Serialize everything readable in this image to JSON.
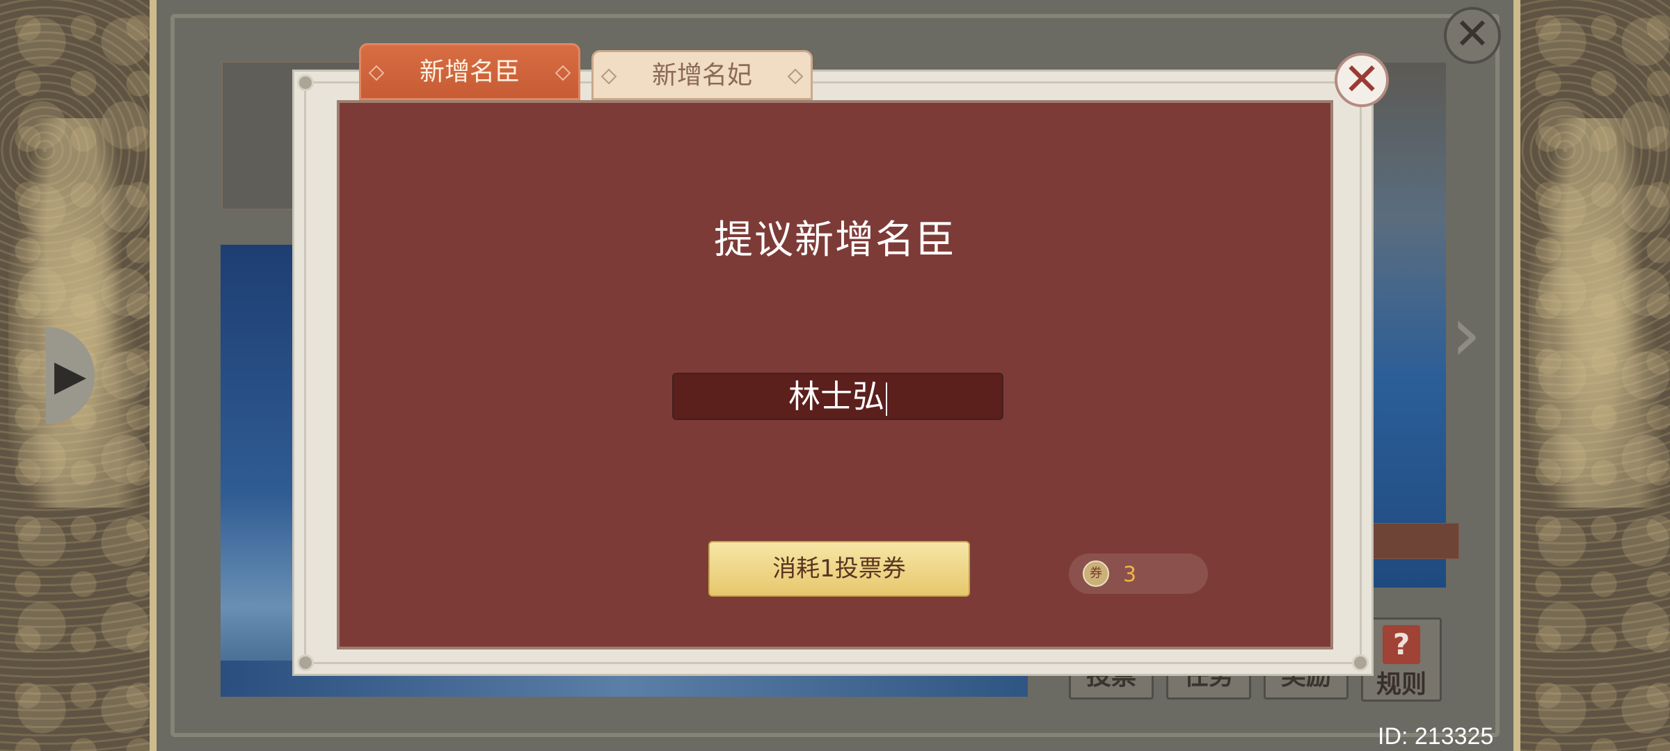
{
  "background": {
    "buttons": [
      "投票",
      "任务",
      "奖励"
    ],
    "rules_label": "规则",
    "rules_icon_glyph": "?",
    "close_glyph": "✕"
  },
  "modal": {
    "tabs": [
      {
        "label": "新增名臣",
        "active": true
      },
      {
        "label": "新增名妃",
        "active": false
      }
    ],
    "title": "提议新增名臣",
    "name_input_value": "林士弘",
    "confirm_button": "消耗1投票券",
    "ticket_icon_glyph": "券",
    "ticket_count": "3",
    "close_glyph": "✕"
  },
  "footer": {
    "id_text": "ID: 213325"
  },
  "colors": {
    "panel_red": "#7d3b37",
    "tab_active": "#d86d43",
    "tab_inactive": "#f1dcc4",
    "confirm_gold": "#e7c76d",
    "ticket_count": "#f0b34a"
  }
}
